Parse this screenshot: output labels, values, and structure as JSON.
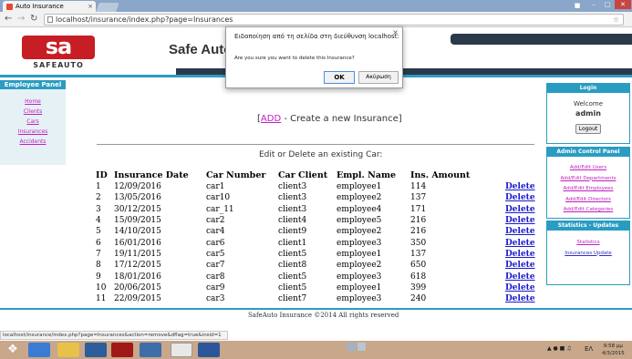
{
  "browser": {
    "tab_title": "Auto Insurance",
    "tab_close": "×",
    "url": "localhost/insurance/index.php?page=Insurances",
    "status_url": "localhost/insurance/index.php?page=Insurances&action=remove&dflag=true&insid=1"
  },
  "site": {
    "logo_mark": "sa",
    "logo_word": "SAFEAUTO",
    "title": "Safe Auto"
  },
  "left_panel": {
    "heading": "Employee Panel",
    "links": [
      "Home",
      "Clients",
      "Cars",
      "Insurances",
      "Accidents"
    ]
  },
  "login_panel": {
    "heading": "Login",
    "welcome": "Welcome",
    "user": "admin",
    "logout_label": "Logout"
  },
  "admin_panel": {
    "heading": "Admin Control Panel",
    "links": [
      "Add/Edit Users",
      "Add/Edit Departments",
      "Add/Edit Employees",
      "Add/Edit Directors",
      "Add/Edit Categories"
    ]
  },
  "stats_panel": {
    "heading": "Statistics - Updates",
    "links": [
      "Statistics",
      "Insurances Update"
    ]
  },
  "main": {
    "add_prefix": "[",
    "add_link": "ADD",
    "add_suffix": " - Create a new Insurance]",
    "section_title": "Edit or Delete an existing Car:",
    "columns": [
      "ID",
      "Insurance Date",
      "Car Number",
      "Car Client",
      "Empl. Name",
      "Ins. Amount"
    ],
    "delete_label": "Delete",
    "rows": [
      [
        "1",
        "12/09/2016",
        "car1",
        "client3",
        "employee1",
        "114"
      ],
      [
        "2",
        "13/05/2016",
        "car10",
        "client3",
        "employee2",
        "137"
      ],
      [
        "3",
        "30/12/2015",
        "car_11",
        "client3",
        "employee4",
        "171"
      ],
      [
        "4",
        "15/09/2015",
        "car2",
        "client4",
        "employee5",
        "216"
      ],
      [
        "5",
        "14/10/2015",
        "car4",
        "client9",
        "employee2",
        "216"
      ],
      [
        "6",
        "16/01/2016",
        "car6",
        "client1",
        "employee3",
        "350"
      ],
      [
        "7",
        "19/11/2015",
        "car5",
        "client5",
        "employee1",
        "137"
      ],
      [
        "8",
        "17/12/2015",
        "car7",
        "client8",
        "employee2",
        "650"
      ],
      [
        "9",
        "18/01/2016",
        "car8",
        "client5",
        "employee3",
        "618"
      ],
      [
        "10",
        "20/06/2015",
        "car9",
        "client5",
        "employee1",
        "399"
      ],
      [
        "11",
        "22/09/2015",
        "car3",
        "client7",
        "employee3",
        "240"
      ]
    ]
  },
  "footer": "SafeAuto Insurance ©2014 All rights reserved",
  "dialog": {
    "title": "Ειδοποίηση από τη σελίδα στη διεύθυνση localhost:",
    "message": "Are you sure you want to delete this Insurance?",
    "ok_label": "OK",
    "cancel_label": "Ακύρωση",
    "close": "×"
  },
  "taskbar": {
    "lang": "ΕΛ",
    "time": "9:58 μμ",
    "date": "4/3/2015"
  },
  "colors": {
    "accent": "#2a9cc2",
    "brand_red": "#c71d24",
    "header_dark": "#2b3a4a",
    "link_magenta": "#c020c0",
    "delete_blue": "#1a1acc"
  }
}
